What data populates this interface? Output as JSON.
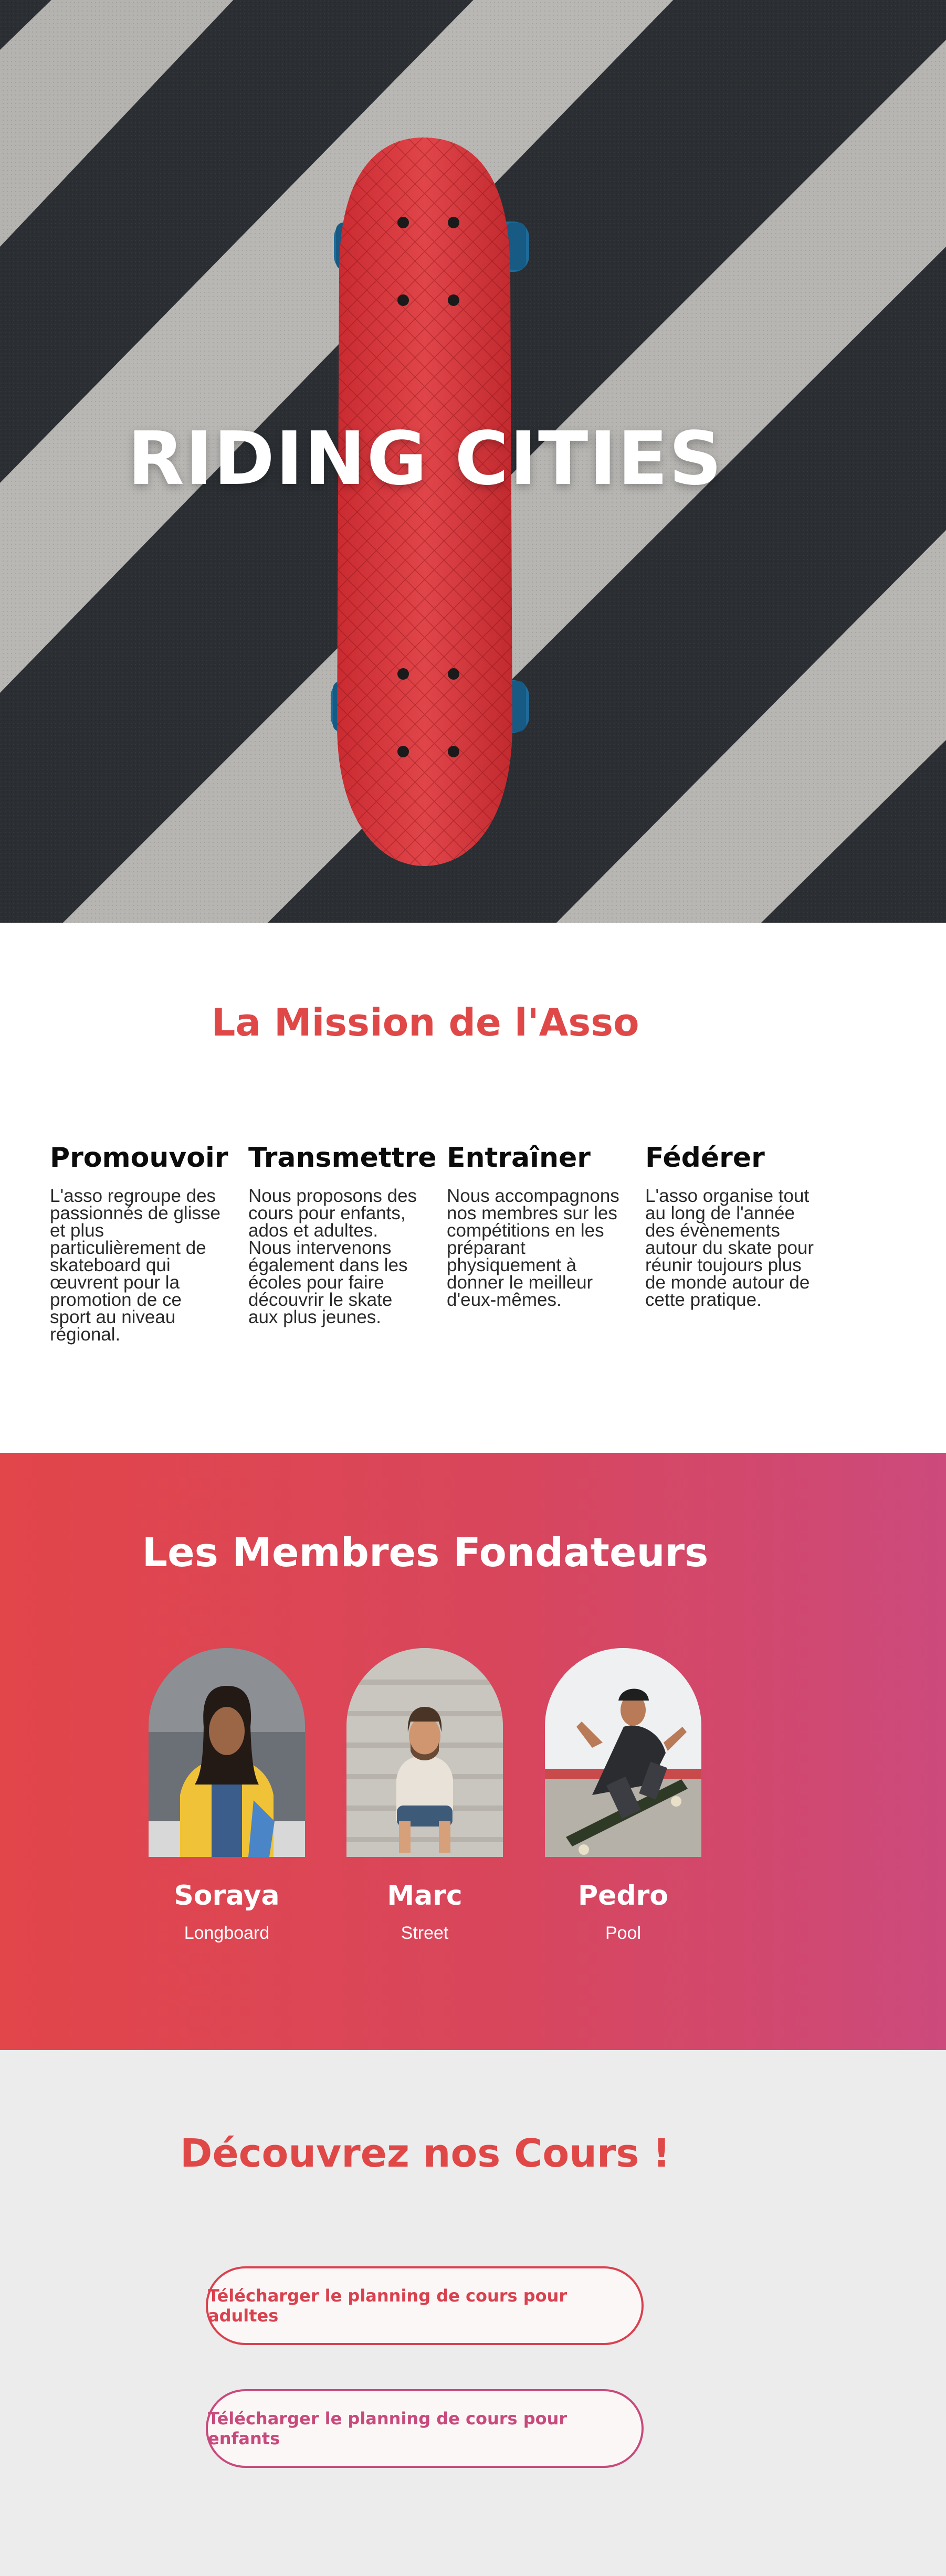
{
  "hero": {
    "title": "RIDING CITIES"
  },
  "mission": {
    "title": "La Mission de l'Asso",
    "columns": [
      {
        "heading": "Promouvoir",
        "text": "L'asso regroupe des passionnés de glisse et plus particulièrement de skateboard qui œuvrent pour la promotion de ce sport au niveau régional."
      },
      {
        "heading": "Transmettre",
        "text": "Nous proposons des cours pour enfants, ados et adultes. Nous intervenons également dans les écoles pour faire découvrir le skate aux plus jeunes."
      },
      {
        "heading": "Entraîner",
        "text": "Nous accompagnons nos membres sur les compétitions en les préparant physiquement à donner le meilleur d'eux-mêmes."
      },
      {
        "heading": "Fédérer",
        "text": "L'asso organise tout au long de l'année des évènements autour du skate pour réunir toujours plus de monde autour de cette pratique."
      }
    ]
  },
  "founders": {
    "title": "Les Membres Fondateurs",
    "members": [
      {
        "name": "Soraya",
        "style": "Longboard"
      },
      {
        "name": "Marc",
        "style": "Street"
      },
      {
        "name": "Pedro",
        "style": "Pool"
      }
    ]
  },
  "courses": {
    "title": "Découvrez nos Cours !",
    "adults_button": "Télécharger le planning de cours pour adultes",
    "kids_button": "Télécharger le planning de cours pour enfants"
  },
  "colors": {
    "accent_red": "#e04848",
    "gradient_start": "#e2454a",
    "gradient_end": "#cc4a7c",
    "skateboard_deck": "#d8363b",
    "wheels": "#1f6f9c",
    "courses_bg": "#ececec"
  }
}
